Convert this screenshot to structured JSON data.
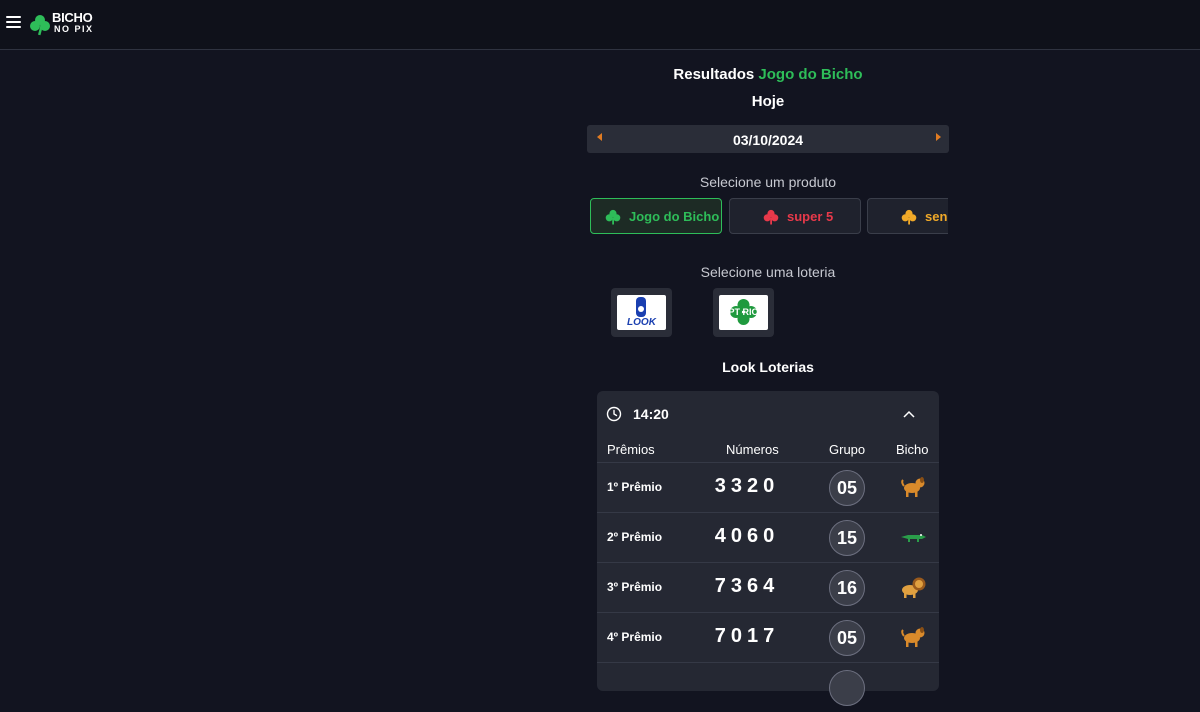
{
  "header": {
    "logo_line1": "BICHO",
    "logo_line2": "NO PIX",
    "icons": [
      "hamburger-menu-icon",
      "clover-logo-icon"
    ]
  },
  "page": {
    "title_prefix": "Resultados",
    "title_accent": "Jogo do Bicho",
    "subtitle": "Hoje",
    "date": "03/10/2024"
  },
  "products": {
    "label": "Selecione um produto",
    "items": [
      {
        "label": "Jogo do Bicho",
        "color": "#2ebd59",
        "active": true
      },
      {
        "label": "super 5",
        "color": "#e8394a",
        "active": false
      },
      {
        "label": "seni",
        "color": "#f0a928",
        "active": false
      }
    ]
  },
  "lotteries": {
    "label": "Selecione uma loteria",
    "items": [
      {
        "name": "Look",
        "logo_text": "LOOK"
      },
      {
        "name": "PT Rio",
        "logo_text": "PT RIO"
      }
    ]
  },
  "results": {
    "lottery_name": "Look Loterias",
    "time": "14:20",
    "columns": [
      "Prêmios",
      "Números",
      "Grupo",
      "Bicho"
    ],
    "rows": [
      {
        "premio": "1º Prêmio",
        "numeros": "3320",
        "grupo": "05",
        "bicho_icon": "dog-icon"
      },
      {
        "premio": "2º Prêmio",
        "numeros": "4060",
        "grupo": "15",
        "bicho_icon": "alligator-icon"
      },
      {
        "premio": "3º Prêmio",
        "numeros": "7364",
        "grupo": "16",
        "bicho_icon": "lion-icon"
      },
      {
        "premio": "4º Prêmio",
        "numeros": "7017",
        "grupo": "05",
        "bicho_icon": "dog-icon"
      }
    ]
  },
  "colors": {
    "background": "#121420",
    "accent_green": "#2ebd59",
    "arrow_orange": "#e07b22",
    "card": "#252833"
  }
}
